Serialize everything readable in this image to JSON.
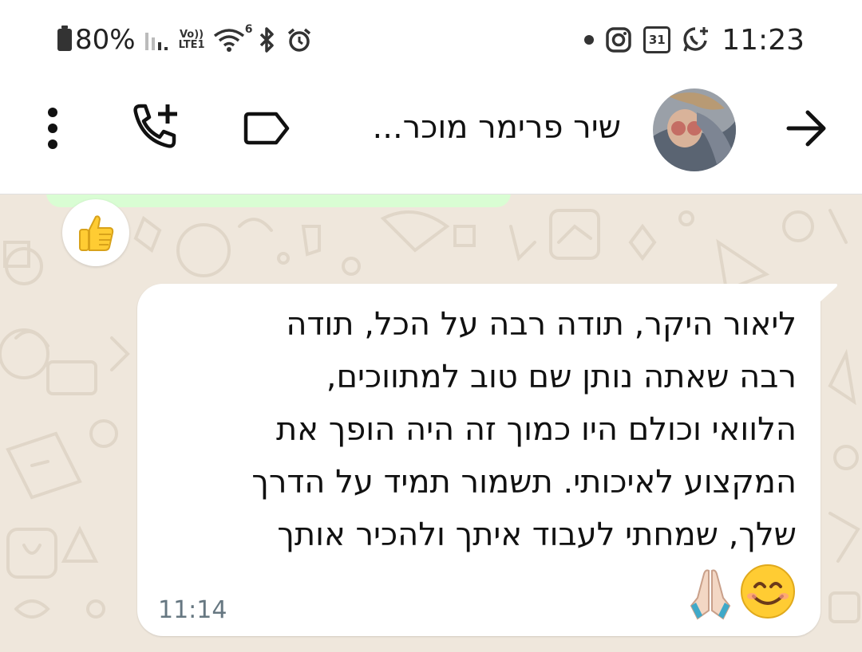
{
  "status_bar": {
    "battery": "80%",
    "volte_top": "Vo))",
    "volte_bottom": "LTE1",
    "wifi_badge": "6",
    "calendar_day": "31",
    "time": "11:23"
  },
  "header": {
    "contact_name": "שיר פרימר מוכר..."
  },
  "chat": {
    "reaction_emoji": "thumbs-up",
    "message": {
      "lines": [
        "ליאור היקר, תודה רבה על הכל, תודה",
        "רבה שאתה נותן שם טוב למתווכים,",
        "הלוואי וכולם היו כמוך זה היה הופך את",
        "המקצוע לאיכותי. תשמור תמיד על הדרך",
        "שלך, שמחתי לעבוד איתך ולהכיר אותך"
      ],
      "emojis": [
        "smiling-face",
        "folded-hands"
      ],
      "time": "11:14"
    }
  },
  "colors": {
    "chat_bg": "#efe7dc",
    "bubble_bg": "#ffffff",
    "prev_bubble_bg": "#d9fdd3",
    "time_color": "#667781"
  }
}
